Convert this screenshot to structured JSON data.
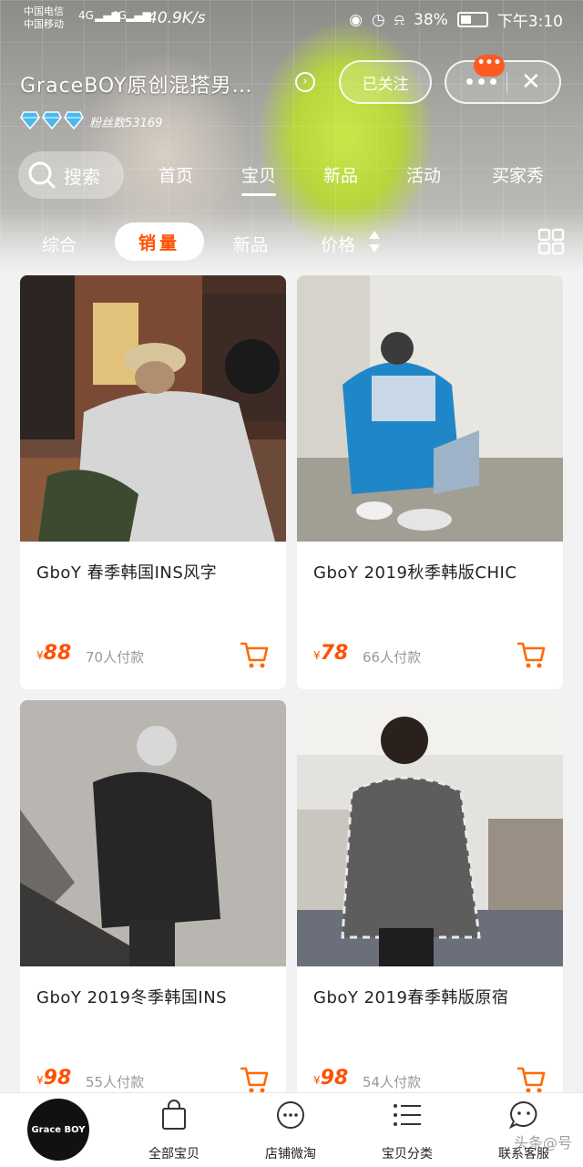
{
  "status": {
    "carrier1": "中国电信",
    "carrier2": "中国移动",
    "net1": "4G",
    "net2": "4G",
    "speed": "40.9K/s",
    "battery": "38%",
    "time": "下午3:10"
  },
  "shop": {
    "name": "GraceBOY原创混搭男…",
    "follow_label": "已关注",
    "badge": "•••",
    "fans": "粉丝数53169"
  },
  "nav": {
    "search_label": "搜索",
    "tabs": [
      "首页",
      "宝贝",
      "新品",
      "活动",
      "买家秀"
    ],
    "active_tab": "宝贝"
  },
  "filters": {
    "items": [
      "综合",
      "销量",
      "新品",
      "价格"
    ],
    "active": "销量"
  },
  "products": [
    {
      "title": "GboY 春季韩国INS风字",
      "currency": "¥",
      "price": "88",
      "sold": "70人付款"
    },
    {
      "title": "GboY 2019秋季韩版CHIC",
      "currency": "¥",
      "price": "78",
      "sold": "66人付款"
    },
    {
      "title": "GboY 2019冬季韩国INS",
      "currency": "¥",
      "price": "98",
      "sold": "55人付款"
    },
    {
      "title": "GboY 2019春季韩版原宿",
      "currency": "¥",
      "price": "98",
      "sold": "54人付款"
    }
  ],
  "bottom": {
    "logo_text": "Grace BOY",
    "tabs": [
      "全部宝贝",
      "店铺微淘",
      "宝贝分类",
      "联系客服"
    ]
  },
  "watermark": "头条@号",
  "colors": {
    "accent": "#ff5000",
    "badge": "#ff5a1f"
  }
}
